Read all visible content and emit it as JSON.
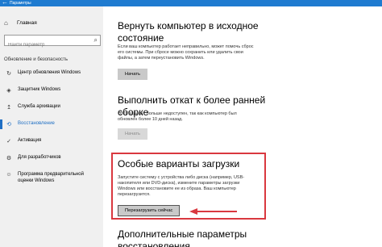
{
  "window": {
    "title": "Параметры",
    "back_icon": "back-arrow-icon"
  },
  "sidebar": {
    "home_label": "Главная",
    "search_placeholder": "Найти параметр",
    "group_title": "Обновление и безопасность",
    "items": [
      {
        "label": "Центр обновления Windows",
        "icon": "refresh-icon"
      },
      {
        "label": "Защитник Windows",
        "icon": "shield-icon"
      },
      {
        "label": "Служба архивации",
        "icon": "backup-icon"
      },
      {
        "label": "Восстановление",
        "icon": "history-icon",
        "active": true
      },
      {
        "label": "Активация",
        "icon": "check-circle-icon"
      },
      {
        "label": "Для разработчиков",
        "icon": "developer-icon"
      },
      {
        "label": "Программа предварительной оценки Windows",
        "icon": "insider-icon"
      }
    ]
  },
  "main": {
    "reset": {
      "title": "Вернуть компьютер в исходное состояние",
      "description": "Если ваш компьютер работает неправильно, может помочь сброс его системы. При сбросе можно сохранить или удалить свои файлы, а затем переустановить Windows.",
      "button": "Начать"
    },
    "rollback": {
      "title": "Выполнить откат к более ранней сборке",
      "description": "Этот вариант больше недоступен, так как компьютер был обновлен более 10 дней назад.",
      "button": "Начать"
    },
    "advanced": {
      "title": "Особые варианты загрузки",
      "description": "Запустите систему с устройства либо диска (например, USB-накопителя или DVD-диска), измените параметры загрузки Windows или восстановите ее из образа. Ваш компьютер перезагрузится.",
      "button": "Перезагрузить сейчас"
    },
    "more": {
      "title": "Дополнительные параметры восстановления"
    }
  },
  "colors": {
    "accent": "#1f6fc4",
    "highlight": "#d9383f"
  }
}
